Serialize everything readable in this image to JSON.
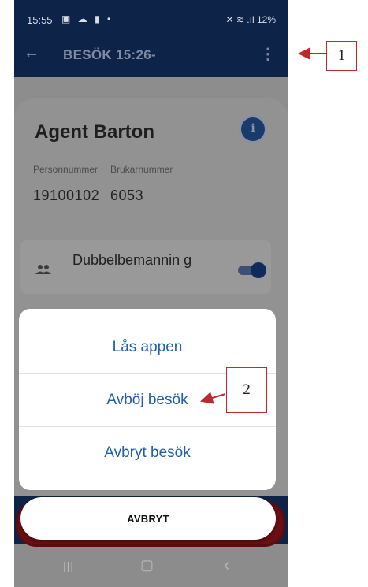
{
  "status_bar": {
    "time": "15:55",
    "left_icons": "▣ ☁ ▮ •",
    "right_icons": "✕ ≋ .ıl",
    "battery": "12%"
  },
  "app_bar": {
    "back_icon": "←",
    "title": "BESÖK 15:26-",
    "menu_icon": "⋮"
  },
  "client": {
    "name": "Agent Barton",
    "info_icon": "i",
    "personnummer_label": "Personnummer",
    "personnummer_value": "19100102",
    "brukarnummer_label": "Brukarnummer",
    "brukarnummer_value": "6053"
  },
  "dubbelbemanning": {
    "label": "Dubbelbemannin g",
    "enabled": true
  },
  "action_sheet": {
    "items": [
      "Lås appen",
      "Avböj besök",
      "Avbryt besök"
    ],
    "cancel_label": "AVBRYT"
  },
  "nav_bar": {
    "recents_icon": "|||",
    "home_icon": "▢",
    "back_icon": "‹"
  },
  "annotations": {
    "callout_1": "1",
    "callout_2": "2"
  },
  "colors": {
    "header_bg": "#0d2347",
    "accent_text": "#1f5fae",
    "callout_border": "#c0272d",
    "arrow": "#c0272d"
  }
}
